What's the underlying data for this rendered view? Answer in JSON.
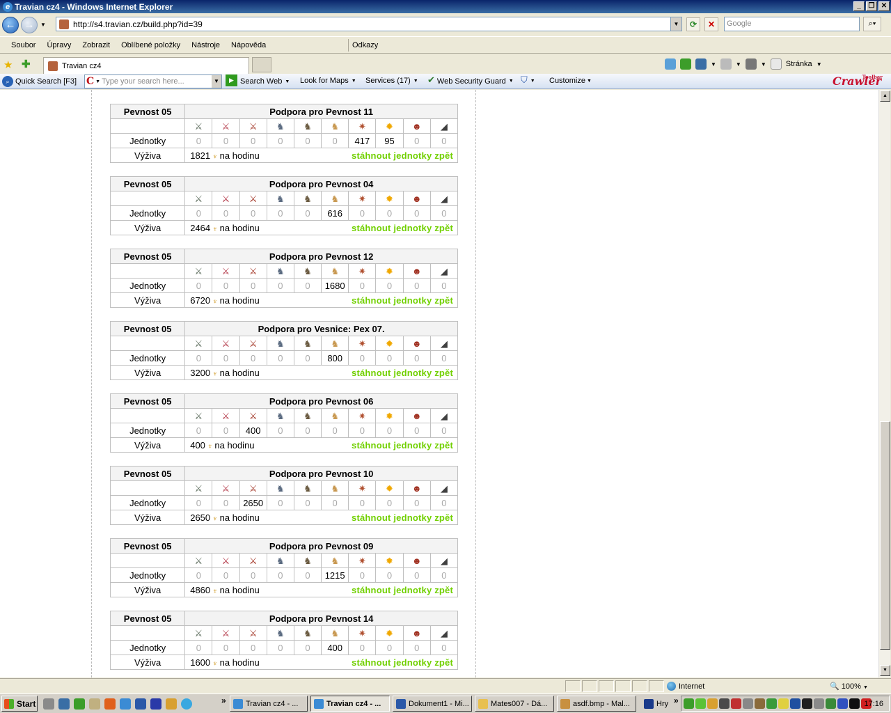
{
  "window": {
    "title": "Travian cz4 - Windows Internet Explorer"
  },
  "address": {
    "url": "http://s4.travian.cz/build.php?id=39",
    "search_placeholder": "Google"
  },
  "menu": {
    "items": [
      "Soubor",
      "Úpravy",
      "Zobrazit",
      "Oblíbené položky",
      "Nástroje",
      "Nápověda"
    ],
    "links": "Odkazy"
  },
  "tabs": {
    "active_label": "Travian cz4",
    "page_menu": "Stránka"
  },
  "crawler": {
    "quick_search": "Quick Search [F3]",
    "search_placeholder": "Type your search here...",
    "search_web": "Search Web",
    "look_for_maps": "Look for Maps",
    "services": "Services (17)",
    "security_guard": "Web Security Guard",
    "customize": "Customize",
    "logo": "Crawler",
    "logo_tag": "Toolbar"
  },
  "troops": {
    "source_village": "Pevnost 05",
    "row_units": "Jednotky",
    "row_upkeep": "Výživa",
    "per_hour": "na hodinu",
    "withdraw": "stáhnout jednotky zpět",
    "unit_icons": [
      "legionnaire-icon",
      "praetorian-icon",
      "imperian-icon",
      "equites-legati-icon",
      "equites-imperatoris-icon",
      "equites-caesaris-icon",
      "battering-ram-icon",
      "fire-catapult-icon",
      "senator-icon",
      "settler-icon"
    ],
    "blocks": [
      {
        "title": "Podpora pro Pevnost 11",
        "counts": [
          "0",
          "0",
          "0",
          "0",
          "0",
          "0",
          "417",
          "95",
          "0",
          "0"
        ],
        "upkeep": "1821"
      },
      {
        "title": "Podpora pro Pevnost 04",
        "counts": [
          "0",
          "0",
          "0",
          "0",
          "0",
          "616",
          "0",
          "0",
          "0",
          "0"
        ],
        "upkeep": "2464"
      },
      {
        "title": "Podpora pro Pevnost 12",
        "counts": [
          "0",
          "0",
          "0",
          "0",
          "0",
          "1680",
          "0",
          "0",
          "0",
          "0"
        ],
        "upkeep": "6720"
      },
      {
        "title": "Podpora pro Vesnice: Pex 07.",
        "counts": [
          "0",
          "0",
          "0",
          "0",
          "0",
          "800",
          "0",
          "0",
          "0",
          "0"
        ],
        "upkeep": "3200"
      },
      {
        "title": "Podpora pro Pevnost 06",
        "counts": [
          "0",
          "0",
          "400",
          "0",
          "0",
          "0",
          "0",
          "0",
          "0",
          "0"
        ],
        "upkeep": "400"
      },
      {
        "title": "Podpora pro Pevnost 10",
        "counts": [
          "0",
          "0",
          "2650",
          "0",
          "0",
          "0",
          "0",
          "0",
          "0",
          "0"
        ],
        "upkeep": "2650"
      },
      {
        "title": "Podpora pro Pevnost 09",
        "counts": [
          "0",
          "0",
          "0",
          "0",
          "0",
          "1215",
          "0",
          "0",
          "0",
          "0"
        ],
        "upkeep": "4860"
      },
      {
        "title": "Podpora pro Pevnost 14",
        "counts": [
          "0",
          "0",
          "0",
          "0",
          "0",
          "400",
          "0",
          "0",
          "0",
          "0"
        ],
        "upkeep": "1600"
      }
    ]
  },
  "status": {
    "zone": "Internet",
    "zoom": "100%"
  },
  "taskbar": {
    "start": "Start",
    "buttons": [
      "Travian cz4 - ...",
      "Travian cz4 - ...",
      "Dokument1 - Mi...",
      "Mates007 - Dá...",
      "asdf.bmp - Mal...",
      "Hry"
    ],
    "clock": "17:16"
  }
}
